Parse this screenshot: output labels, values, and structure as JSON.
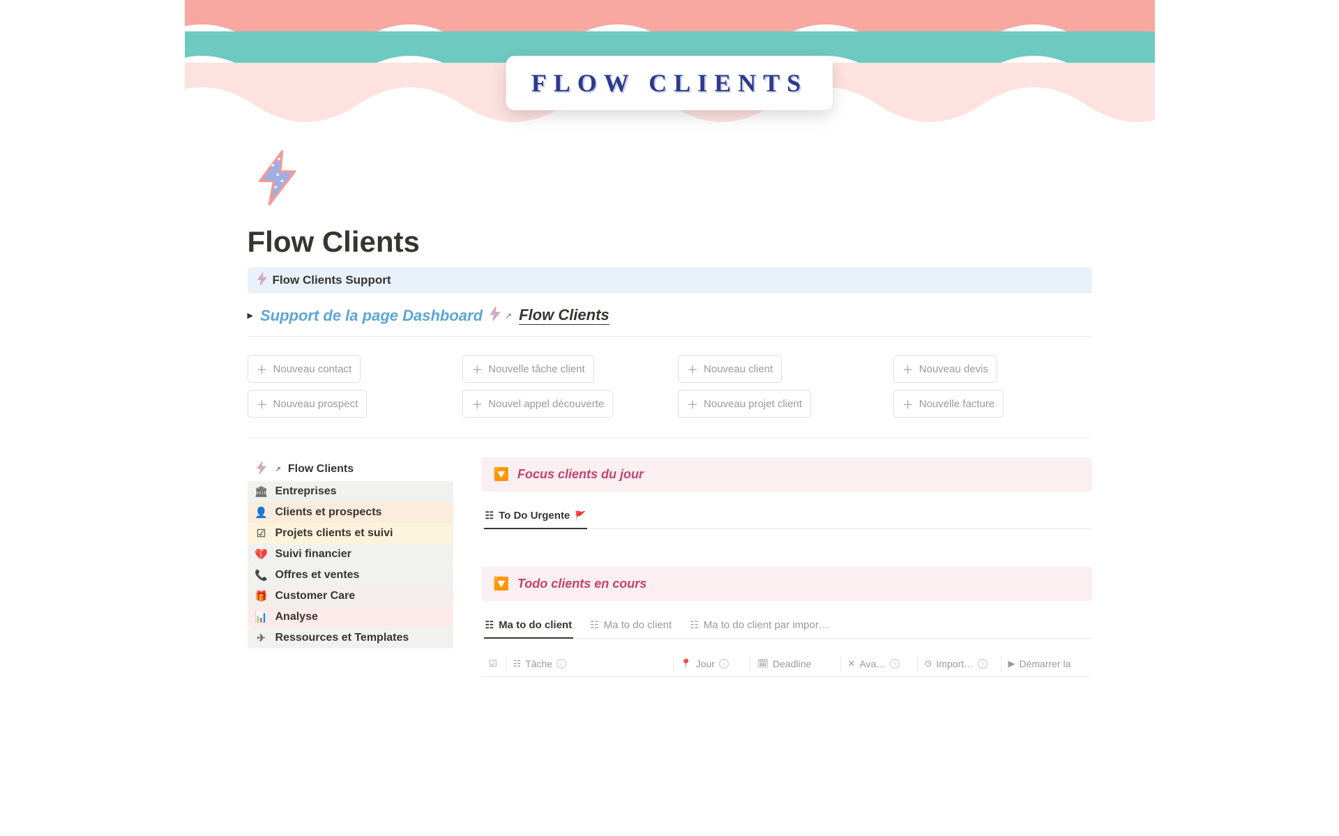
{
  "cover_title": "FLOW CLIENTS",
  "page_title": "Flow Clients",
  "support_bar": {
    "icon": "🗲",
    "label": "Flow Clients Support"
  },
  "toggle": {
    "link_text": "Support de la page Dashboard",
    "icon": "🗲",
    "page_ref": "Flow Clients"
  },
  "actions": {
    "col1": [
      "Nouveau contact",
      "Nouveau prospect"
    ],
    "col2": [
      "Nouvelle tâche client",
      "Nouvel appel découverte"
    ],
    "col3": [
      "Nouveau client",
      "Nouveau projet client"
    ],
    "col4": [
      "Nouveau devis",
      "Nouvelle facture"
    ]
  },
  "sidebar": [
    {
      "icon": "bolt",
      "label": "Flow Clients",
      "cls": "nav-flow",
      "has_arrow": true
    },
    {
      "icon": "bank",
      "label": "Entreprises",
      "cls": "nav-ent"
    },
    {
      "icon": "person",
      "label": "Clients et prospects",
      "cls": "nav-cli"
    },
    {
      "icon": "checklist",
      "label": "Projets clients et suivi",
      "cls": "nav-prj"
    },
    {
      "icon": "heart",
      "label": "Suivi financier",
      "cls": "nav-fin"
    },
    {
      "icon": "phone",
      "label": "Offres et ventes",
      "cls": "nav-off"
    },
    {
      "icon": "gift",
      "label": "Customer Care",
      "cls": "nav-cc"
    },
    {
      "icon": "chart",
      "label": "Analyse",
      "cls": "nav-ana"
    },
    {
      "icon": "send",
      "label": "Ressources et Templates",
      "cls": "nav-res"
    }
  ],
  "callouts": {
    "focus": {
      "label": "Focus clients du jour"
    },
    "todo": {
      "label": "Todo clients en cours"
    }
  },
  "urgent_tab": {
    "label": "To Do Urgente"
  },
  "tabs": [
    {
      "label": "Ma to do client",
      "active": true
    },
    {
      "label": "Ma to do client",
      "active": false
    },
    {
      "label": "Ma to do client par impor…",
      "active": false
    }
  ],
  "columns": {
    "tache": "Tâche",
    "jour": "Jour",
    "deadline": "Deadline",
    "avancement": "Ava…",
    "importance": "Import…",
    "demarrer": "Démarrer la"
  }
}
